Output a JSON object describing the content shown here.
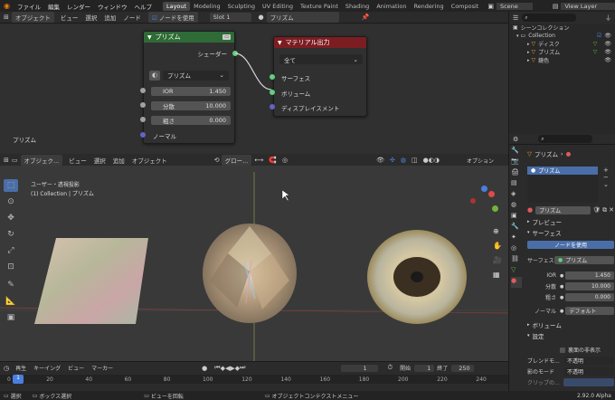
{
  "topbar": {
    "menus": [
      "ファイル",
      "編集",
      "レンダー",
      "ウィンドウ",
      "ヘルプ"
    ],
    "workspaces": [
      "Layout",
      "Modeling",
      "Sculpting",
      "UV Editing",
      "Texture Paint",
      "Shading",
      "Animation",
      "Rendering",
      "Composit"
    ],
    "active_workspace": "Layout",
    "scene": "Scene",
    "view_layer": "View Layer"
  },
  "node_editor": {
    "object_mode": "オブジェクト",
    "menus": [
      "ビュー",
      "選択",
      "追加",
      "ノード"
    ],
    "use_nodes_label": "ノードを使用",
    "slot": "Slot 1",
    "material_name": "プリズム",
    "corner_label": "プリズム",
    "shader_node": {
      "title": "プリズム",
      "output_label": "シェーダー",
      "preset": "プリズム",
      "fields": [
        {
          "label": "IOR",
          "value": "1.450"
        },
        {
          "label": "分散",
          "value": "10.000"
        },
        {
          "label": "粗さ",
          "value": "0.000"
        }
      ],
      "normal_label": "ノーマル"
    },
    "output_node": {
      "title": "マテリアル出力",
      "target": "全て",
      "inputs": [
        "サーフェス",
        "ボリューム",
        "ディスプレイスメント"
      ]
    }
  },
  "viewport": {
    "mode": "オブジェク...",
    "menus": [
      "ビュー",
      "選択",
      "追加",
      "オブジェクト"
    ],
    "transform": "グロー...",
    "options": "オプション",
    "view_name": "ユーザー・透視投影",
    "collection_info": "(1) Collection | プリズム"
  },
  "timeline": {
    "playback": "再生",
    "keying": "キーイング",
    "view": "ビュー",
    "marker": "マーカー",
    "current_frame": "1",
    "start_label": "開始",
    "start": "1",
    "end_label": "終了",
    "end": "250",
    "ticks": [
      "0",
      "20",
      "40",
      "60",
      "80",
      "100",
      "120",
      "140",
      "160",
      "180",
      "200",
      "220",
      "240"
    ]
  },
  "statusbar": {
    "select": "選択",
    "box_select": "ボックス選択",
    "rotate_view": "ビューを回転",
    "context_menu": "オブジェクトコンテクストメニュー",
    "version": "2.92.0 Alpha"
  },
  "outliner": {
    "root": "シーンコレクション",
    "collection": "Collection",
    "items": [
      "ディスク",
      "プリズム",
      "鏡色"
    ]
  },
  "properties": {
    "object_name": "プリズム",
    "slot_item": "プリズム",
    "material_name": "プリズム",
    "preview_label": "プレビュー",
    "surface_label": "サーフェス",
    "use_nodes_button": "ノードを使用",
    "surface_field_label": "サーフェス",
    "surface_value": "プリズム",
    "fields": [
      {
        "label": "IOR",
        "value": "1.450"
      },
      {
        "label": "分散",
        "value": "10.000"
      },
      {
        "label": "粗さ",
        "value": "0.000"
      }
    ],
    "normal_label": "ノーマル",
    "normal_value": "デフォルト",
    "volume_label": "ボリューム",
    "settings_label": "設定",
    "backface_label": "裏面の非表示",
    "blend_label": "ブレンドモ...",
    "blend_value": "不透明",
    "shadow_label": "影のモード",
    "shadow_value": "不透明",
    "clip_label": "クリップの..."
  }
}
